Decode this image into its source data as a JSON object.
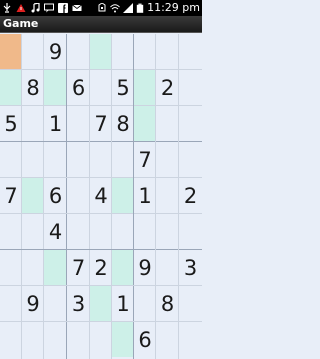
{
  "status_bar": {
    "time": "11:29 pm",
    "icons": [
      "usb-icon",
      "warning-icon",
      "music-icon",
      "voicemail-icon",
      "facebook-icon",
      "mail-icon",
      "usb-debug-icon",
      "wifi-icon",
      "signal-icon",
      "battery-icon"
    ]
  },
  "app": {
    "title": "Game"
  },
  "colors": {
    "highlight": "#cdf0e8",
    "selected": "#f0b98a",
    "grid_bg": "#e8eef8"
  },
  "board": {
    "rows": [
      [
        "",
        "",
        "9",
        "",
        "",
        "",
        "",
        "",
        ""
      ],
      [
        "",
        "8",
        "",
        "6",
        "",
        "5",
        "",
        "2",
        ""
      ],
      [
        "5",
        "",
        "1",
        "",
        "7",
        "8",
        "",
        "",
        ""
      ],
      [
        "",
        "",
        "",
        "",
        "",
        "",
        "7",
        "",
        ""
      ],
      [
        "7",
        "",
        "6",
        "",
        "4",
        "",
        "1",
        "",
        "2"
      ],
      [
        "",
        "",
        "4",
        "",
        "",
        "",
        "",
        "",
        ""
      ],
      [
        "",
        "",
        "",
        "7",
        "2",
        "",
        "9",
        "",
        "3"
      ],
      [
        "",
        "9",
        "",
        "3",
        "",
        "1",
        "",
        "8",
        ""
      ],
      [
        "",
        "",
        "",
        "",
        "",
        "",
        "6",
        "",
        ""
      ]
    ],
    "selected_cell": [
      0,
      0
    ],
    "highlighted_cells": [
      [
        0,
        4
      ],
      [
        1,
        0
      ],
      [
        1,
        2
      ],
      [
        1,
        6
      ],
      [
        2,
        6
      ],
      [
        4,
        1
      ],
      [
        4,
        5
      ],
      [
        6,
        2
      ],
      [
        6,
        5
      ],
      [
        7,
        4
      ],
      [
        8,
        5
      ]
    ]
  }
}
